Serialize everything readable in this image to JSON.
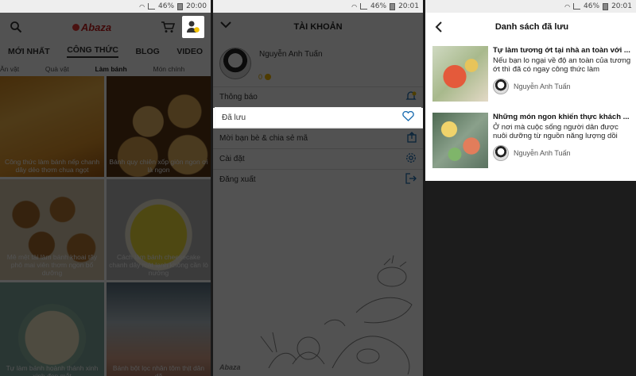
{
  "status": [
    {
      "battery": "46%",
      "time": "20:00"
    },
    {
      "battery": "46%",
      "time": "20:01"
    },
    {
      "battery": "46%",
      "time": "20:01"
    }
  ],
  "home": {
    "logo": "Abaza",
    "tabs": [
      {
        "label": "MỚI NHẤT"
      },
      {
        "label": "CÔNG THỨC"
      },
      {
        "label": "BLOG"
      },
      {
        "label": "VIDEO"
      }
    ],
    "active_tab": 1,
    "subtabs": [
      {
        "label": "Ăn vặt"
      },
      {
        "label": "Quà vặt"
      },
      {
        "label": "Làm bánh"
      },
      {
        "label": "Món chính"
      }
    ],
    "active_subtab": 2,
    "recipes": [
      {
        "caption": "Công thức làm bánh nếp chanh dây dẻo thơm chua ngọt"
      },
      {
        "caption": "Bánh quy chiên xốp giòn ngon ơi là ngon"
      },
      {
        "caption": "Mê mệt tài làm bánh khoai tây phô mai viên thơm ngon bổ dưỡng"
      },
      {
        "caption": "Cách làm bánh cheesecake chanh dây mát lạnh không cần lò nướng"
      },
      {
        "caption": "Tự làm bánh hoành thánh xinh xinh đẹp mắt"
      },
      {
        "caption": "Bánh bột lọc nhân tôm thịt dân dã"
      }
    ]
  },
  "account": {
    "title": "TÀI KHOẢN",
    "user_name": "Nguyễn Anh Tuấn",
    "points": "0",
    "menu": [
      {
        "label": "Thông báo",
        "icon": "bell-icon"
      },
      {
        "label": "Đã lưu",
        "icon": "heart-icon"
      },
      {
        "label": "Mời bạn bè & chia sẻ mã",
        "icon": "share-icon"
      },
      {
        "label": "Cài đặt",
        "icon": "gear-icon"
      },
      {
        "label": "Đăng xuất",
        "icon": "logout-icon"
      }
    ],
    "footer_logo": "Abaza"
  },
  "saved": {
    "title": "Danh sách đã lưu",
    "items": [
      {
        "title": "Tự làm tương ớt tại nhà an toàn với ...",
        "desc": "Nếu bạn lo ngại về độ an toàn của tương ớt thì đã có ngay công thức làm",
        "author": "Nguyễn Anh Tuấn"
      },
      {
        "title": "Những món ngon khiến thực khách ...",
        "desc": "Ở nơi mà cuộc sống người dân được nuôi dưỡng từ nguồn năng lượng dồi",
        "author": "Nguyễn Anh Tuấn"
      }
    ]
  },
  "colors": {
    "brand_red": "#c41e1e",
    "coin": "#f2b600",
    "overlay": "rgba(0,0,0,0.68)"
  }
}
